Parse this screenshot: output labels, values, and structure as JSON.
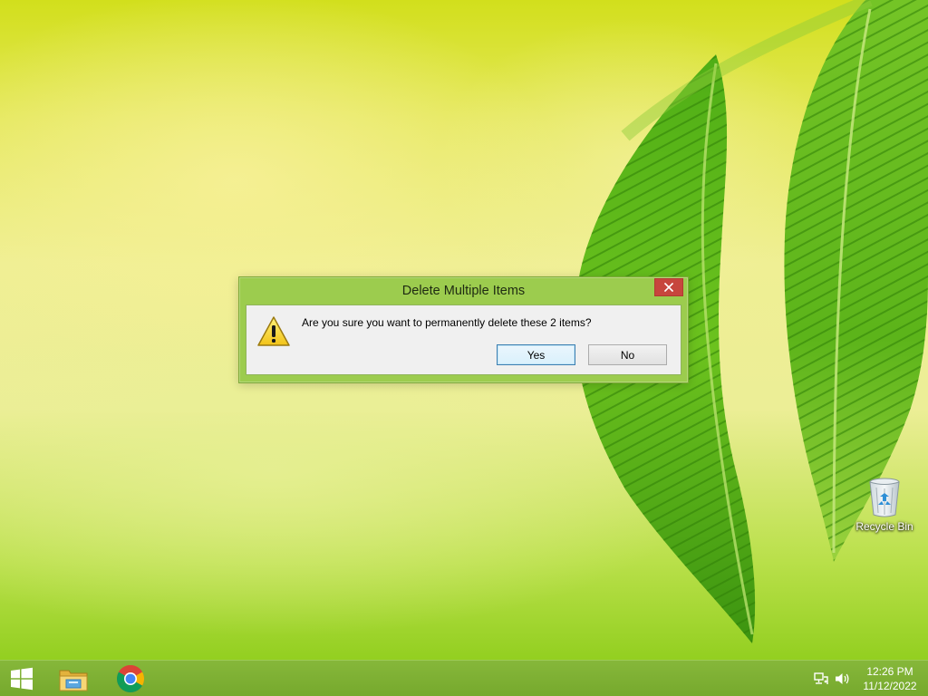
{
  "desktop": {
    "icons": [
      {
        "label": "Recycle Bin",
        "icon": "recycle-bin-icon"
      }
    ]
  },
  "dialog": {
    "title": "Delete Multiple Items",
    "message": "Are you sure you want to permanently delete these 2 items?",
    "icon": "warning-icon",
    "buttons": {
      "yes": "Yes",
      "no": "No"
    },
    "default_button": "yes",
    "colors": {
      "frame": "#9ccc4e",
      "close": "#c7463d",
      "client": "#f0f0f0"
    }
  },
  "taskbar": {
    "pinned": [
      {
        "name": "start-button",
        "icon": "windows-logo-icon"
      },
      {
        "name": "file-explorer",
        "icon": "folder-icon"
      },
      {
        "name": "google-chrome",
        "icon": "chrome-icon"
      }
    ],
    "tray": {
      "network_icon": "network-icon",
      "volume_icon": "speaker-icon"
    },
    "clock": {
      "time": "12:26 PM",
      "date": "11/12/2022"
    },
    "color": "#7db034"
  }
}
